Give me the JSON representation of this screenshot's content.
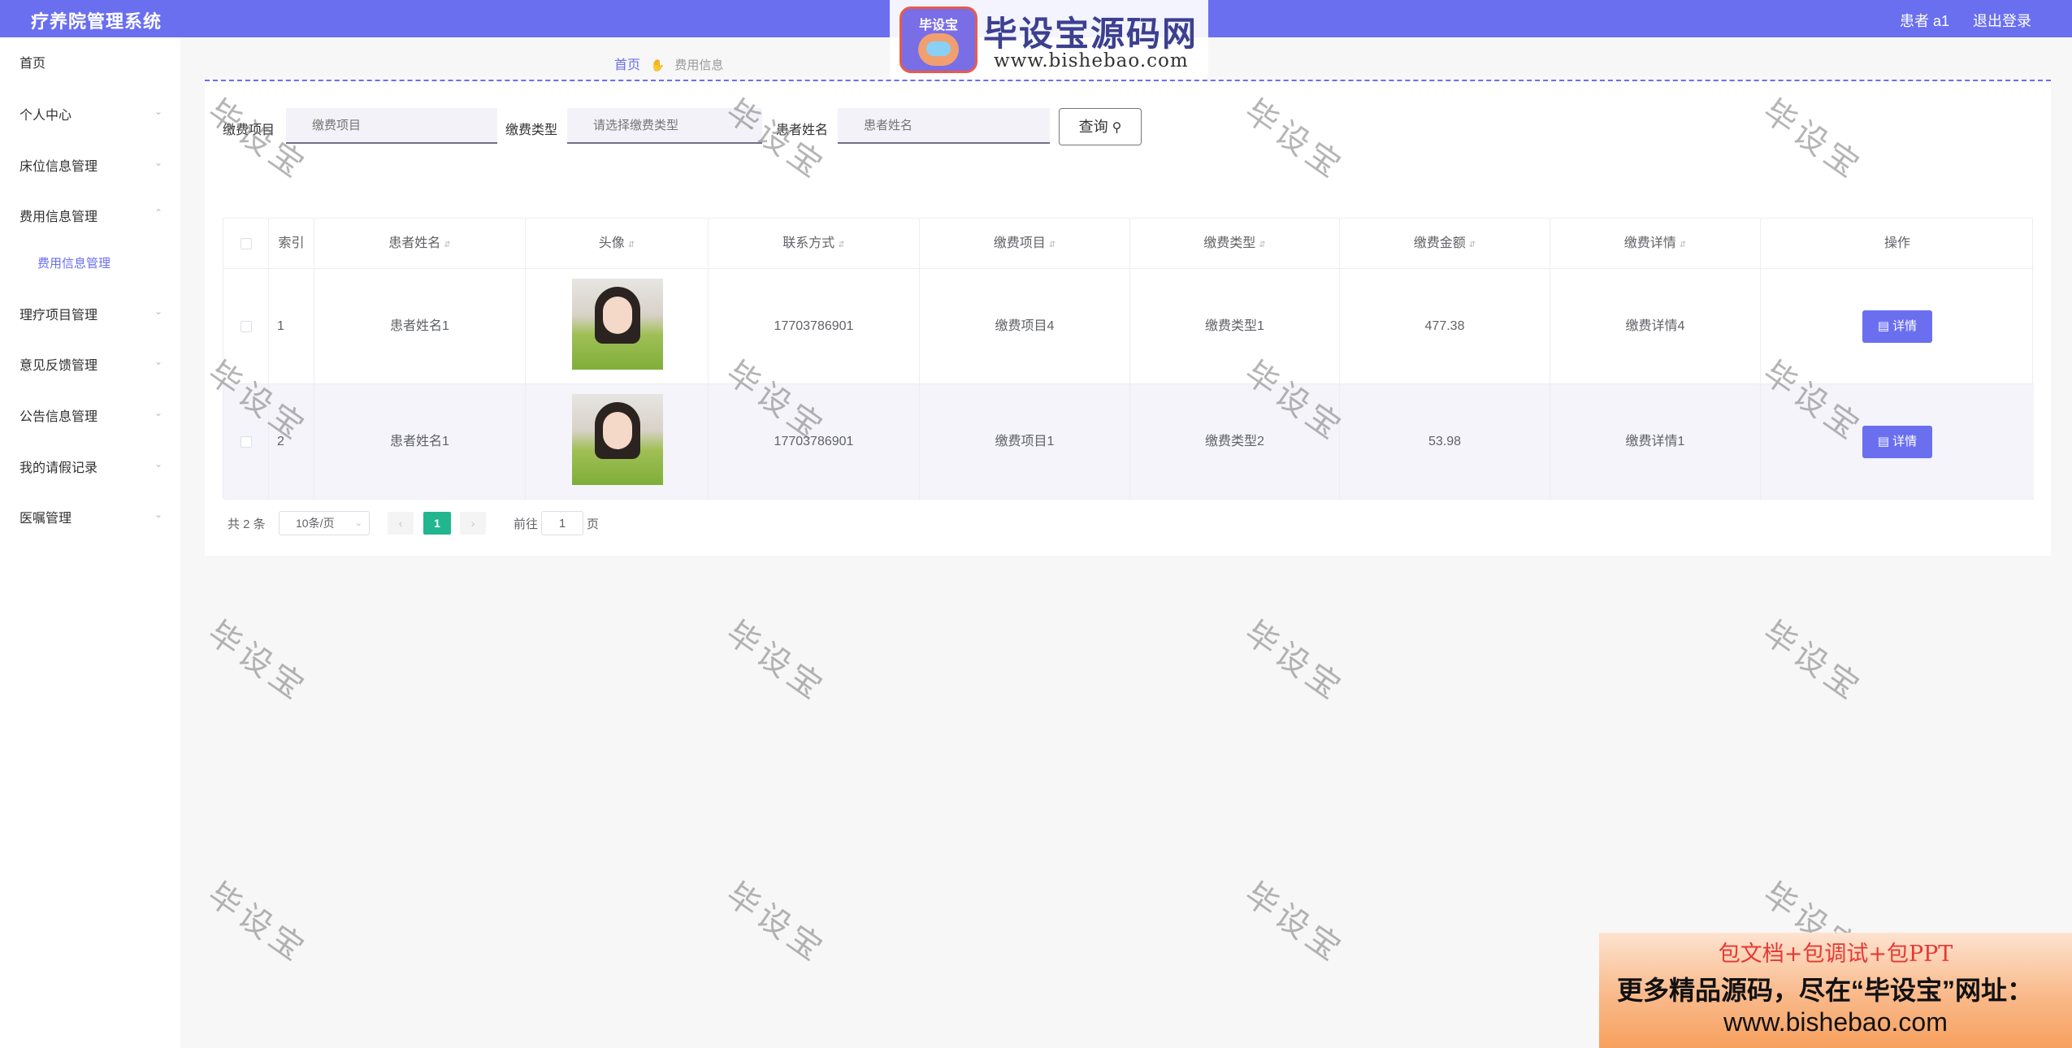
{
  "header": {
    "title": "疗养院管理系统",
    "user": "患者 a1",
    "logout": "退出登录"
  },
  "watermark_logo": {
    "badge": "毕设宝",
    "brand": "毕设宝源码网",
    "url": "www.bishebao.com"
  },
  "sidebar": {
    "items": [
      {
        "label": "首页"
      },
      {
        "label": "个人中心"
      },
      {
        "label": "床位信息管理"
      },
      {
        "label": "费用信息管理"
      },
      {
        "label": "理疗项目管理"
      },
      {
        "label": "意见反馈管理"
      },
      {
        "label": "公告信息管理"
      },
      {
        "label": "我的请假记录"
      },
      {
        "label": "医嘱管理"
      }
    ],
    "sub_item": "费用信息管理"
  },
  "breadcrumb": {
    "home": "首页",
    "current": "费用信息"
  },
  "search": {
    "item_label": "缴费项目",
    "item_placeholder": "缴费项目",
    "type_label": "缴费类型",
    "type_placeholder": "请选择缴费类型",
    "name_label": "患者姓名",
    "name_placeholder": "患者姓名",
    "query_button": "查询"
  },
  "table": {
    "columns": [
      "索引",
      "患者姓名",
      "头像",
      "联系方式",
      "缴费项目",
      "缴费类型",
      "缴费金额",
      "缴费详情",
      "操作"
    ],
    "rows": [
      {
        "index": "1",
        "name": "患者姓名1",
        "phone": "17703786901",
        "item": "缴费项目4",
        "type": "缴费类型1",
        "amount": "477.38",
        "detail": "缴费详情4",
        "action": "详情"
      },
      {
        "index": "2",
        "name": "患者姓名1",
        "phone": "17703786901",
        "item": "缴费项目1",
        "type": "缴费类型2",
        "amount": "53.98",
        "detail": "缴费详情1",
        "action": "详情"
      }
    ]
  },
  "pagination": {
    "total": "共 2 条",
    "page_size": "10条/页",
    "current_page": "1",
    "goto_label": "前往",
    "goto_value": "1",
    "page_suffix": "页"
  },
  "watermark_text": "毕设宝",
  "ad": {
    "line1": "包文档+包调试+包PPT",
    "line2": "更多精品源码，尽在“毕设宝”网址：",
    "line3": "www.bishebao.com"
  },
  "colors": {
    "accent": "#6a6ff0",
    "page_active": "#21b68e"
  }
}
